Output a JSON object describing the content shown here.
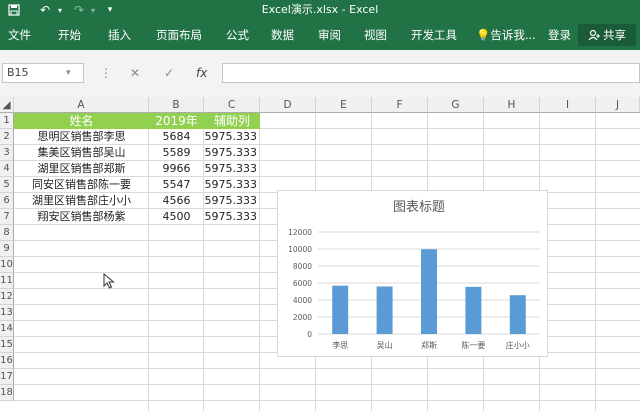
{
  "window": {
    "title": "Excel演示.xlsx  -  Excel"
  },
  "ribbon": {
    "tabs": [
      "文件",
      "开始",
      "插入",
      "页面布局",
      "公式",
      "数据",
      "审阅",
      "视图",
      "开发工具"
    ],
    "tell_me": "告诉我...",
    "login": "登录",
    "share": "共享"
  },
  "formula_bar": {
    "name_box": "B15",
    "cancel": "✕",
    "enter": "✓",
    "fx": "fx",
    "value": ""
  },
  "columns": [
    "A",
    "B",
    "C",
    "D",
    "E",
    "F",
    "G",
    "H",
    "I",
    "J"
  ],
  "rows": [
    "1",
    "2",
    "3",
    "4",
    "5",
    "6",
    "7",
    "8",
    "9",
    "10",
    "11",
    "12",
    "13",
    "14",
    "15",
    "16",
    "17",
    "18"
  ],
  "table": {
    "headers": [
      "姓名",
      "2019年",
      "辅助列"
    ],
    "rows": [
      [
        "思明区销售部李思",
        "5684",
        "5975.333"
      ],
      [
        "集美区销售部吴山",
        "5589",
        "5975.333"
      ],
      [
        "湖里区销售部郑斯",
        "9966",
        "5975.333"
      ],
      [
        "同安区销售部陈一要",
        "5547",
        "5975.333"
      ],
      [
        "湖里区销售部庄小小",
        "4566",
        "5975.333"
      ],
      [
        "翔安区销售部杨紫",
        "4500",
        "5975.333"
      ]
    ]
  },
  "chart_data": {
    "type": "bar",
    "title": "图表标题",
    "categories": [
      "李思",
      "吴山",
      "郑斯",
      "陈一要",
      "庄小小"
    ],
    "values": [
      5684,
      5589,
      9966,
      5547,
      4566
    ],
    "ylim": [
      0,
      12000
    ],
    "yticks": [
      0,
      2000,
      4000,
      6000,
      8000,
      10000,
      12000
    ],
    "ytick_labels": [
      "0",
      "2000",
      "4000",
      "6000",
      "8000",
      "10000",
      "12000"
    ],
    "grid": true,
    "bar_color": "#5b9bd5"
  },
  "colors": {
    "accent": "#217346",
    "header_fill": "#92d050"
  }
}
